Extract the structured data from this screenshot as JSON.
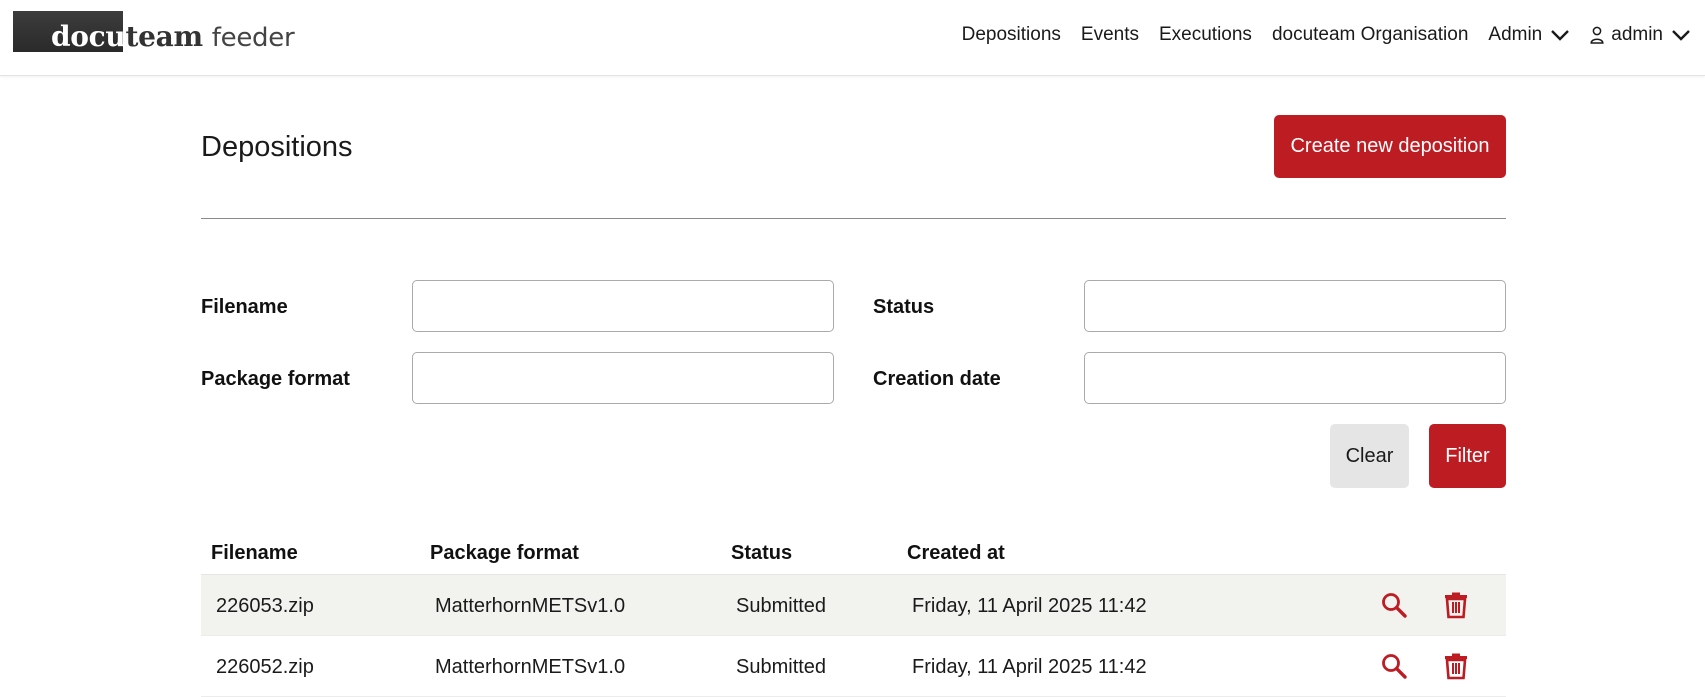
{
  "brand": {
    "part1": "docu",
    "part2": "team",
    "part3": "feeder"
  },
  "nav": {
    "items": [
      {
        "label": "Depositions"
      },
      {
        "label": "Events"
      },
      {
        "label": "Executions"
      },
      {
        "label": "docuteam Organisation"
      }
    ],
    "admin_menu": {
      "label": "Admin",
      "icon": "chevron-down-icon"
    },
    "user_menu": {
      "label": "admin",
      "icon": "user-icon"
    }
  },
  "page": {
    "title": "Depositions",
    "create_button": "Create new deposition"
  },
  "filters": {
    "filename": {
      "label": "Filename",
      "value": "",
      "placeholder": ""
    },
    "status": {
      "label": "Status",
      "value": "",
      "placeholder": ""
    },
    "package_format": {
      "label": "Package format",
      "value": "",
      "placeholder": ""
    },
    "creation_date": {
      "label": "Creation date",
      "value": "",
      "placeholder": ""
    },
    "clear_button": "Clear",
    "filter_button": "Filter"
  },
  "table": {
    "headers": {
      "filename": "Filename",
      "package_format": "Package format",
      "status": "Status",
      "created_at": "Created at"
    },
    "rows": [
      {
        "filename": "226053.zip",
        "package_format": "MatterhornMETSv1.0",
        "status": "Submitted",
        "created_at": "Friday, 11 April 2025 11:42"
      },
      {
        "filename": "226052.zip",
        "package_format": "MatterhornMETSv1.0",
        "status": "Submitted",
        "created_at": "Friday, 11 April 2025 11:42"
      }
    ]
  },
  "colors": {
    "accent": "#bd1c22",
    "row_stripe": "#f2f2ef",
    "clear_bg": "#e5e5e5"
  }
}
